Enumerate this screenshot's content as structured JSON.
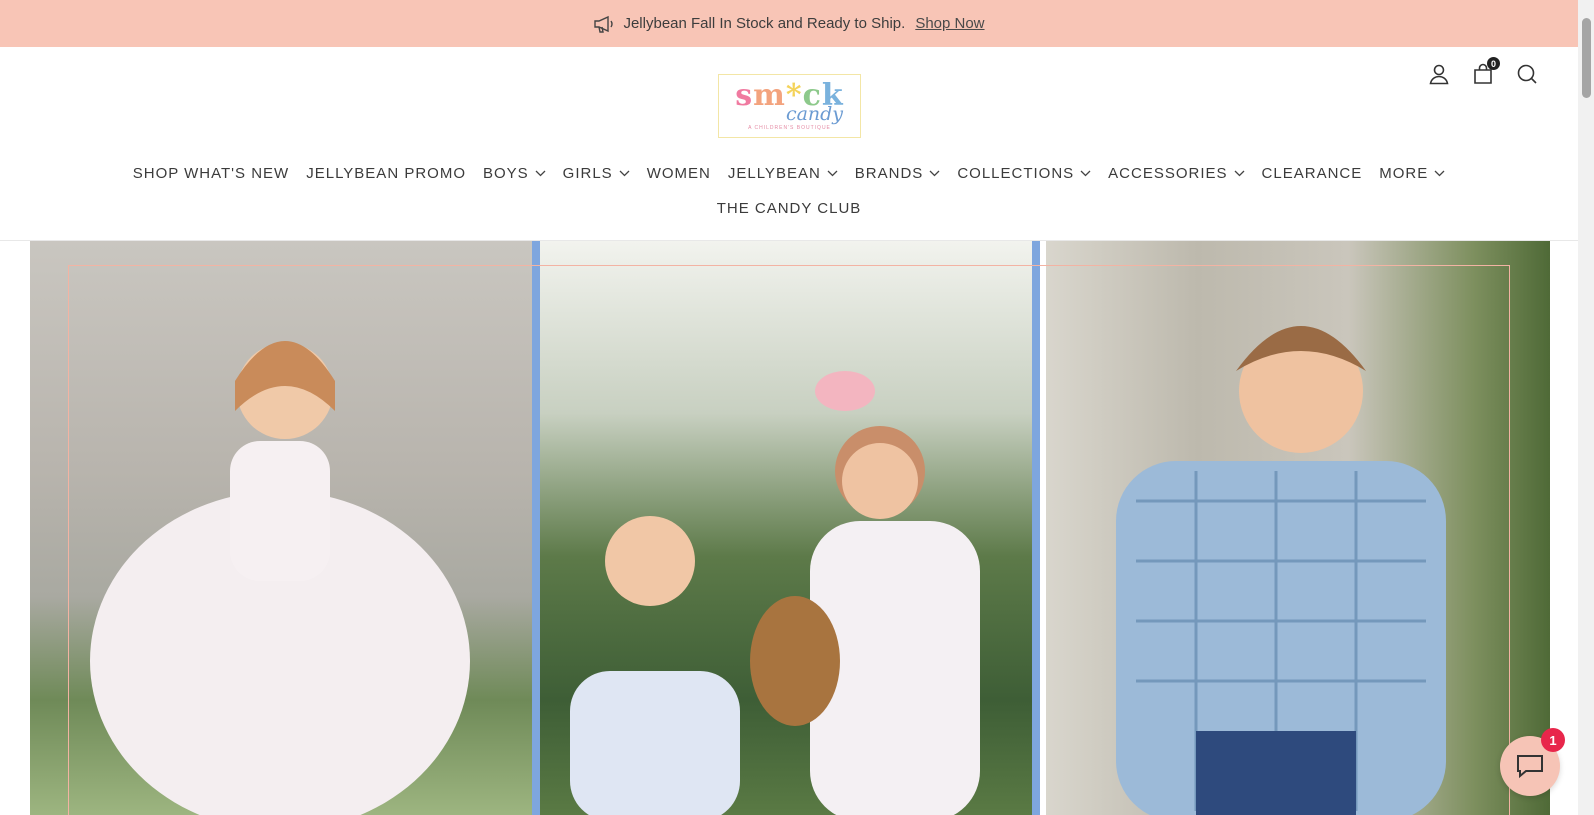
{
  "announcement": {
    "text": "Jellybean Fall In Stock and Ready to Ship.",
    "link": "Shop Now",
    "icon": "megaphone-icon"
  },
  "logo": {
    "line1": [
      "s",
      "m",
      "*",
      "c",
      "k"
    ],
    "line2": "candy",
    "tagline": "A CHILDREN'S BOUTIQUE"
  },
  "header_icons": {
    "account": "user-icon",
    "cart": "cart-icon",
    "cart_count": "0",
    "search": "search-icon"
  },
  "nav": {
    "items": [
      {
        "label": "SHOP WHAT'S NEW",
        "dropdown": false
      },
      {
        "label": "JELLYBEAN PROMO",
        "dropdown": false
      },
      {
        "label": "BOYS",
        "dropdown": true
      },
      {
        "label": "GIRLS",
        "dropdown": true
      },
      {
        "label": "WOMEN",
        "dropdown": false
      },
      {
        "label": "JELLYBEAN",
        "dropdown": true
      },
      {
        "label": "BRANDS",
        "dropdown": true
      },
      {
        "label": "COLLECTIONS",
        "dropdown": true
      },
      {
        "label": "ACCESSORIES",
        "dropdown": true
      },
      {
        "label": "CLEARANCE",
        "dropdown": false
      },
      {
        "label": "MORE",
        "dropdown": true
      }
    ],
    "second_row": "THE CANDY CLUB"
  },
  "chat": {
    "badge": "1",
    "icon": "chat-icon"
  },
  "colors": {
    "announcement_bg": "#f8c5b6",
    "divider": "#7ea6de",
    "frame": "#f3b3a3",
    "chat_badge": "#e8264b"
  }
}
